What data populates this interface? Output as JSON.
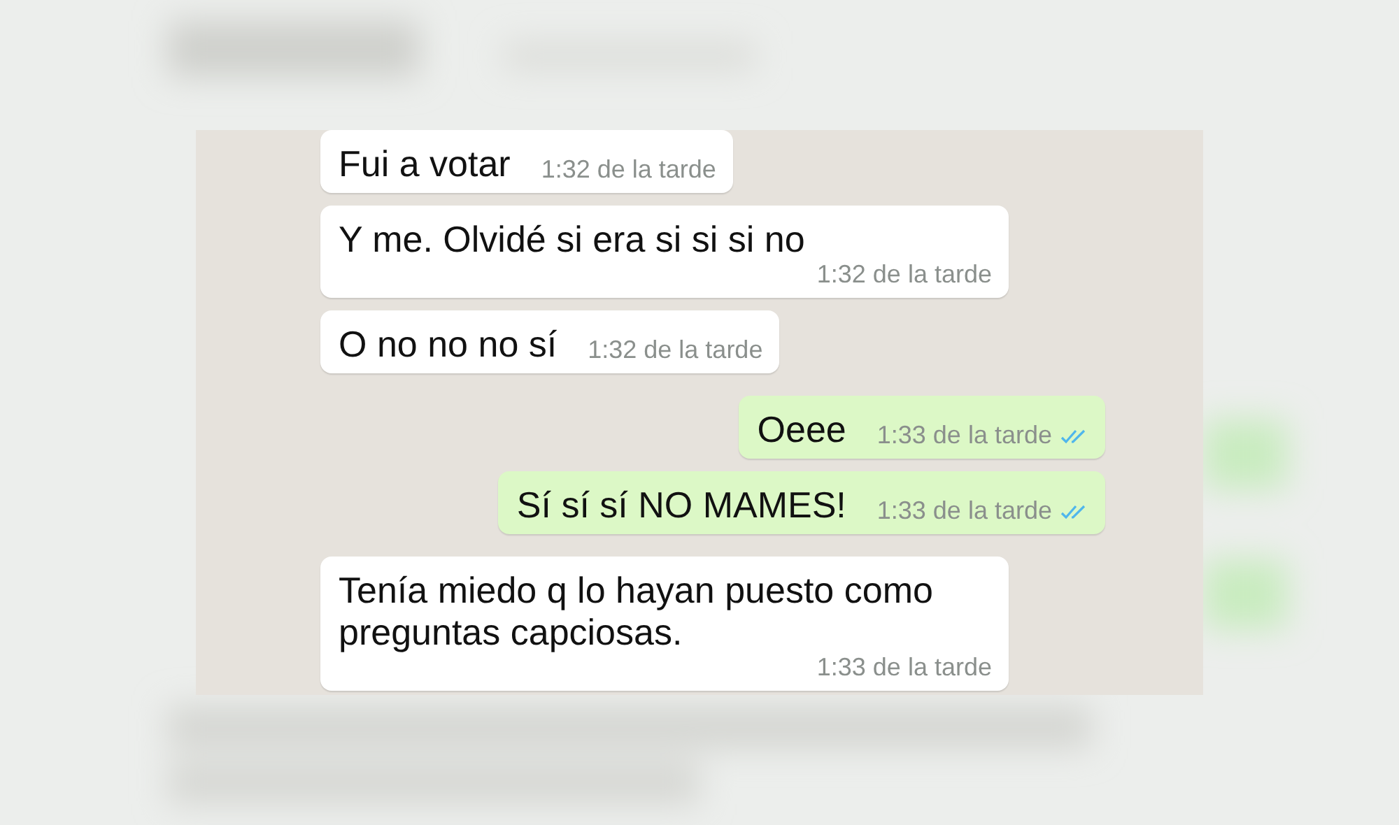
{
  "messages": [
    {
      "kind": "received",
      "text": "Fui a votar",
      "time": "1:32 de la tarde"
    },
    {
      "kind": "received",
      "text": "Y me. Olvidé si era si si si no",
      "time": "1:32 de la tarde"
    },
    {
      "kind": "received",
      "text": "O no no no sí",
      "time": "1:32 de la tarde"
    },
    {
      "kind": "sent",
      "text": "Oeee",
      "time": "1:33 de la tarde",
      "read": true
    },
    {
      "kind": "sent",
      "text": "Sí sí sí NO MAMES!",
      "time": "1:33 de la tarde",
      "read": true
    },
    {
      "kind": "received",
      "text": "Tenía miedo q lo hayan puesto como preguntas capciosas.",
      "time": "1:33 de la tarde"
    }
  ]
}
